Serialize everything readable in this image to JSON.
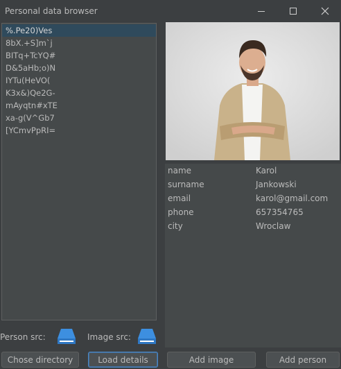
{
  "window": {
    "title": "Personal data browser"
  },
  "people_list": {
    "items": [
      "%.Pe20)Ves",
      "8bX.+S]m`j",
      "BITq+TcYQ#",
      "D&5aHb;o)N",
      "IYTu(HeVO(",
      "K3x&)Qe2G-",
      "mAyqtn#xTE",
      "xa-g(V^Gb7",
      "[YCmvPpRI="
    ],
    "selected_index": 0
  },
  "details": {
    "rows": [
      {
        "key": "name",
        "value": "Karol"
      },
      {
        "key": "surname",
        "value": "Jankowski"
      },
      {
        "key": "email",
        "value": "karol@gmail.com"
      },
      {
        "key": "phone",
        "value": "657354765"
      },
      {
        "key": "city",
        "value": "Wroclaw"
      }
    ]
  },
  "sources": {
    "person_label": "Person src:",
    "image_label": "Image src:",
    "icon": "drive-icon"
  },
  "buttons": {
    "choose_directory": "Chose directory",
    "load_details": "Load details",
    "add_image": "Add image",
    "add_person": "Add person"
  },
  "colors": {
    "background": "#3c3f41",
    "panel": "#45494a",
    "selection": "#2f4a5c",
    "focus": "#4a88c7",
    "drive_blue": "#3d8fe0"
  }
}
